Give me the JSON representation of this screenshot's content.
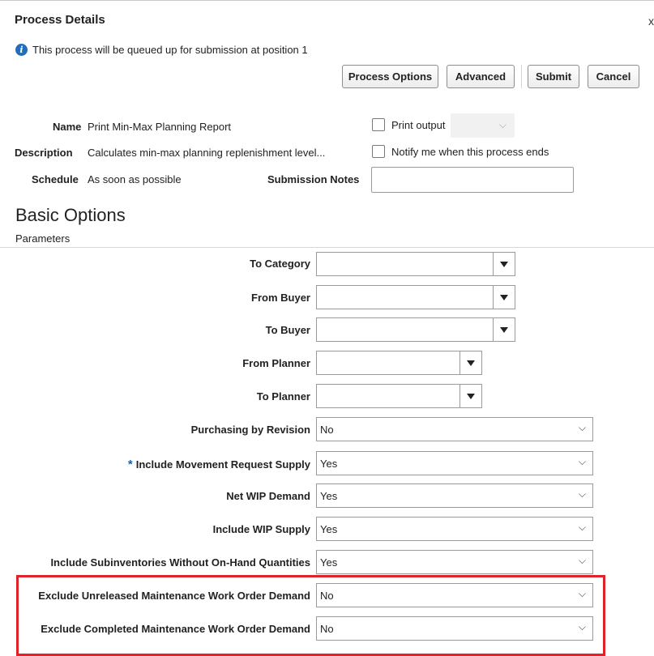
{
  "header": {
    "title": "Process Details",
    "close_glyph": "x"
  },
  "info_message": "This process will be queued up for submission at position 1",
  "toolbar": {
    "process_options": "Process Options",
    "advanced": "Advanced",
    "submit": "Submit",
    "cancel": "Cancel"
  },
  "details": {
    "name_label": "Name",
    "name_value": "Print Min-Max Planning Report",
    "description_label": "Description",
    "description_value": "Calculates min-max planning replenishment level...",
    "schedule_label": "Schedule",
    "schedule_value": "As soon as possible",
    "submission_notes_label": "Submission Notes",
    "print_output_label": "Print output",
    "notify_label": "Notify me when this process ends"
  },
  "section": {
    "title": "Basic Options",
    "subtitle": "Parameters"
  },
  "parameters": [
    {
      "label": "To Category",
      "type": "combo",
      "value": ""
    },
    {
      "label": "From Buyer",
      "type": "combo",
      "value": ""
    },
    {
      "label": "To Buyer",
      "type": "combo",
      "value": ""
    },
    {
      "label": "From Planner",
      "type": "combo",
      "value": ""
    },
    {
      "label": "To Planner",
      "type": "combo",
      "value": ""
    },
    {
      "label": "Purchasing by Revision",
      "type": "select",
      "value": "No"
    },
    {
      "label": "Include Movement Request Supply",
      "type": "select",
      "value": "Yes",
      "required": true
    },
    {
      "label": "Net WIP Demand",
      "type": "select",
      "value": "Yes"
    },
    {
      "label": "Include WIP Supply",
      "type": "select",
      "value": "Yes"
    },
    {
      "label": "Include Subinventories Without On-Hand Quantities",
      "type": "select",
      "value": "Yes"
    },
    {
      "label": "Exclude Unreleased Maintenance Work Order Demand",
      "type": "select",
      "value": "No"
    },
    {
      "label": "Exclude Completed Maintenance Work Order Demand",
      "type": "select",
      "value": "No"
    }
  ],
  "colors": {
    "highlight": "#e0232b",
    "info_icon": "#1f6ebf",
    "required": "#1f5fa8"
  },
  "icons": {
    "info": "info-icon",
    "dropdown": "triangle-down-icon",
    "chevron": "chevron-down-icon",
    "close": "close-icon"
  }
}
